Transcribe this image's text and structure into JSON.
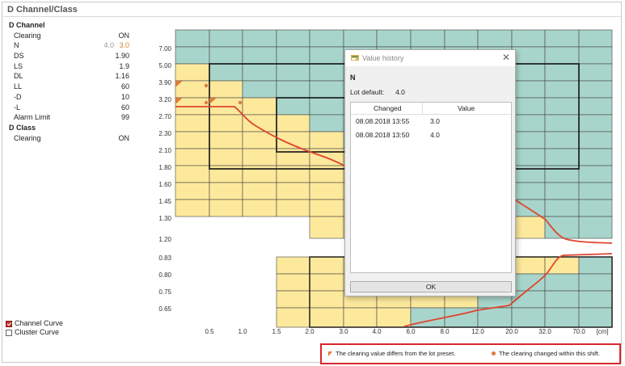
{
  "panel": {
    "title": "D Channel/Class"
  },
  "params": [
    {
      "kind": "section",
      "label": "D Channel"
    },
    {
      "kind": "row",
      "label": "Clearing",
      "value": "ON"
    },
    {
      "kind": "row",
      "label": "N",
      "old": "4.0",
      "value": "3.0",
      "changed": true
    },
    {
      "kind": "row",
      "label": "DS",
      "value": "1.90"
    },
    {
      "kind": "row",
      "label": "LS",
      "value": "1.9"
    },
    {
      "kind": "row",
      "label": "DL",
      "value": "1.16"
    },
    {
      "kind": "row",
      "label": "LL",
      "value": "60"
    },
    {
      "kind": "row",
      "label": "-D",
      "value": "10"
    },
    {
      "kind": "row",
      "label": "-L",
      "value": "60"
    },
    {
      "kind": "row",
      "label": "Alarm Limit",
      "value": "99"
    },
    {
      "kind": "section",
      "label": "D Class"
    },
    {
      "kind": "row",
      "label": "Clearing",
      "value": "ON"
    }
  ],
  "curves": {
    "channel_label": "Channel Curve",
    "channel_checked": true,
    "cluster_label": "Cluster Curve",
    "cluster_checked": false
  },
  "grid": {
    "upper_y_labels": [
      "7.00",
      "5.00",
      "3.90",
      "3.20",
      "2.70",
      "2.30",
      "2.10",
      "1.80",
      "1.60",
      "1.45",
      "1.30",
      "1.20"
    ],
    "lower_y_labels": [
      "0.83",
      "0.80",
      "0.75",
      "0.65"
    ],
    "x_labels": [
      "0.5",
      "1.0",
      "1.5",
      "2.0",
      "3.0",
      "4.0",
      "6.0",
      "8.0",
      "12.0",
      "20.0",
      "32.0",
      "70.0"
    ],
    "x_unit": "[cm]",
    "colors": {
      "teal": "#a8d5cb",
      "yellow": "#fde99c",
      "curve": "#e0452f",
      "marker": "#e07a3a"
    }
  },
  "dialog": {
    "title": "Value history",
    "heading": "N",
    "default_label": "Lot default:",
    "default_value": "4.0",
    "columns": [
      "Changed",
      "Value"
    ],
    "rows": [
      {
        "changed": "08.08.2018 13:55",
        "value": "3.0"
      },
      {
        "changed": "08.08.2018 13:50",
        "value": "4.0"
      }
    ],
    "ok_label": "OK"
  },
  "legend": {
    "item1": "The clearing value differs from the lot preset.",
    "item2": "The clearing changed within this shift."
  }
}
